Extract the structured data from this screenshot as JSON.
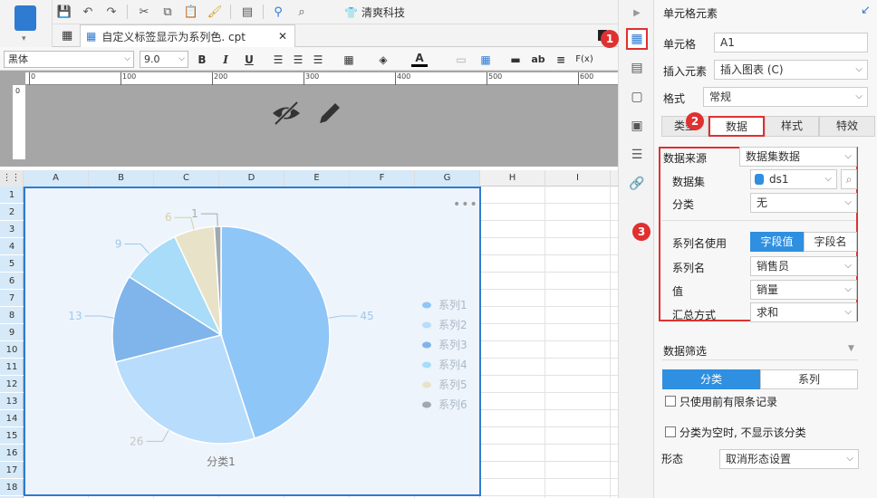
{
  "toolbar": {
    "brand_label": "清爽科技"
  },
  "file_tab": {
    "label": "自定义标签显示为系列色. cpt"
  },
  "format_bar": {
    "font": "黑体",
    "size": "9.0",
    "bold": "B",
    "italic": "I",
    "underline": "U",
    "fx": "F(x)",
    "ab": "ab"
  },
  "ruler": {
    "h_ticks": [
      "0",
      "100",
      "200",
      "300",
      "400",
      "500",
      "600"
    ],
    "v_ticks": [
      "0"
    ]
  },
  "grid": {
    "columns": [
      "A",
      "B",
      "C",
      "D",
      "E",
      "F",
      "G",
      "H",
      "I"
    ],
    "rows": [
      "1",
      "2",
      "3",
      "4",
      "5",
      "6",
      "7",
      "8",
      "9",
      "10",
      "11",
      "12",
      "13",
      "14",
      "15",
      "16",
      "17",
      "18"
    ]
  },
  "chart_data": {
    "type": "pie",
    "categories": [
      "系列1",
      "系列2",
      "系列3",
      "系列4",
      "系列5",
      "系列6"
    ],
    "values": [
      45,
      26,
      13,
      9,
      6,
      1
    ],
    "colors": [
      "#8ec6f8",
      "#b8dcfb",
      "#7fb5ea",
      "#a8dcf8",
      "#e8e2c9",
      "#a0a8b0"
    ],
    "label_colors": [
      "#9fc9ec",
      "#c4c4c4",
      "#9fc9ec",
      "#9fc9ec",
      "#d6cfa8",
      "#aaaaaa"
    ],
    "legend": [
      "系列1",
      "系列2",
      "系列3",
      "系列4",
      "系列5",
      "系列6"
    ],
    "category_label": "分类1",
    "legend_position": "right"
  },
  "panel": {
    "title": "单元格元素",
    "cell_label": "单元格",
    "cell_value": "A1",
    "insert_label": "插入元素",
    "insert_value": "插入图表 (C)",
    "format_label": "格式",
    "format_value": "常规",
    "tabs": [
      "类型",
      "数据",
      "样式",
      "特效"
    ],
    "data_source_label": "数据来源",
    "data_source_value": "数据集数据",
    "dataset_label": "数据集",
    "dataset_value": "ds1",
    "category_label": "分类",
    "category_value": "无",
    "series_name_use_label": "系列名使用",
    "series_name_use_options": [
      "字段值",
      "字段名"
    ],
    "series_name_label": "系列名",
    "series_name_value": "销售员",
    "value_label": "值",
    "value_value": "销量",
    "summary_label": "汇总方式",
    "summary_value": "求和",
    "filter_label": "数据筛选",
    "filter_seg": [
      "分类",
      "系列"
    ],
    "check1": "只使用前有限条记录",
    "check2": "分类为空时, 不显示该分类",
    "shape_label": "形态",
    "shape_value": "取消形态设置"
  },
  "badges": [
    "1",
    "2",
    "3"
  ]
}
